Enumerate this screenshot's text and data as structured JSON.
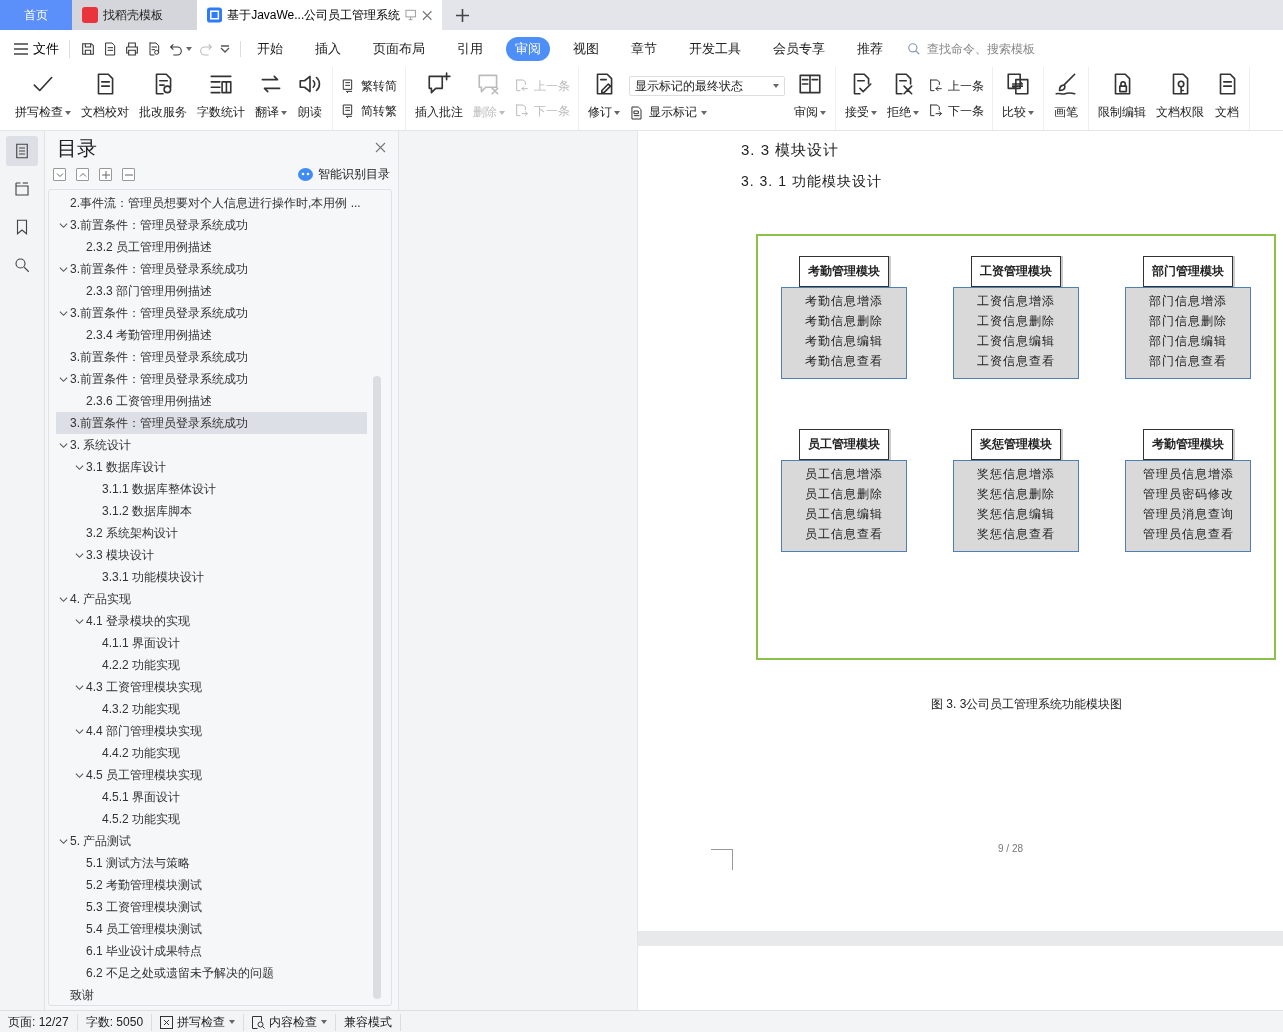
{
  "app_tabs": [
    {
      "kind": "home",
      "label": "首页",
      "selected": false
    },
    {
      "kind": "template",
      "label": "找稻壳模板",
      "selected": false
    },
    {
      "kind": "doc",
      "label": "基于JavaWe...公司员工管理系统",
      "selected": true
    }
  ],
  "menu": {
    "file": "文件",
    "tabs": [
      {
        "label": "开始",
        "selected": false
      },
      {
        "label": "插入",
        "selected": false
      },
      {
        "label": "页面布局",
        "selected": false
      },
      {
        "label": "引用",
        "selected": false
      },
      {
        "label": "审阅",
        "selected": true
      },
      {
        "label": "视图",
        "selected": false
      },
      {
        "label": "章节",
        "selected": false
      },
      {
        "label": "开发工具",
        "selected": false
      },
      {
        "label": "会员专享",
        "selected": false
      },
      {
        "label": "推荐",
        "selected": false
      }
    ],
    "search": {
      "placeholder": "查找命令、搜索模板"
    }
  },
  "ribbon": [
    {
      "items": [
        {
          "kind": "large",
          "label": "拼写检查",
          "caret": true,
          "disabled": false
        },
        {
          "kind": "large",
          "label": "文档校对",
          "caret": false,
          "disabled": false
        },
        {
          "kind": "large",
          "label": "批改服务",
          "caret": false,
          "disabled": false
        },
        {
          "kind": "large",
          "label": "字数统计",
          "caret": false,
          "disabled": false
        },
        {
          "kind": "large",
          "label": "翻译",
          "caret": true,
          "disabled": false
        },
        {
          "kind": "large",
          "label": "朗读",
          "caret": false,
          "disabled": false
        }
      ]
    },
    {
      "items": [
        {
          "kind": "stack",
          "items": [
            {
              "label": "繁转简",
              "caret": false,
              "disabled": false
            },
            {
              "label": "简转繁",
              "caret": false,
              "disabled": false
            }
          ]
        }
      ]
    },
    {
      "items": [
        {
          "kind": "large",
          "label": "插入批注",
          "caret": false,
          "disabled": false
        },
        {
          "kind": "large",
          "label": "删除",
          "caret": true,
          "disabled": true
        },
        {
          "kind": "stack",
          "items": [
            {
              "label": "上一条",
              "caret": false,
              "disabled": true
            },
            {
              "label": "下一条",
              "caret": false,
              "disabled": true
            }
          ]
        }
      ]
    },
    {
      "items": [
        {
          "kind": "large",
          "label": "修订",
          "caret": true,
          "disabled": false
        },
        {
          "kind": "stack",
          "items": [
            {
              "kind": "select",
              "label": "显示标记的最终状态",
              "caret": true
            },
            {
              "label": "显示标记",
              "caret": true,
              "disabled": false
            }
          ]
        },
        {
          "kind": "large",
          "label": "审阅",
          "caret": true,
          "disabled": false
        }
      ]
    },
    {
      "items": [
        {
          "kind": "large",
          "label": "接受",
          "caret": true,
          "disabled": false
        },
        {
          "kind": "large",
          "label": "拒绝",
          "caret": true,
          "disabled": false
        },
        {
          "kind": "stack",
          "items": [
            {
              "label": "上一条",
              "caret": false,
              "disabled": false
            },
            {
              "label": "下一条",
              "caret": false,
              "disabled": false
            }
          ]
        }
      ]
    },
    {
      "items": [
        {
          "kind": "large",
          "label": "比较",
          "caret": true,
          "disabled": false
        }
      ]
    },
    {
      "items": [
        {
          "kind": "large",
          "label": "画笔",
          "caret": false,
          "disabled": false
        }
      ]
    },
    {
      "items": [
        {
          "kind": "large",
          "label": "限制编辑",
          "caret": false,
          "disabled": false
        },
        {
          "kind": "large",
          "label": "文档权限",
          "caret": false,
          "disabled": false
        },
        {
          "kind": "large",
          "label": "文档",
          "caret": false,
          "disabled": false
        }
      ]
    }
  ],
  "rail": [
    {
      "selected": true
    },
    {
      "selected": false
    },
    {
      "selected": false
    },
    {
      "selected": false
    }
  ],
  "outline_panel": {
    "title": "目录",
    "smart_button": "智能识别目录",
    "items": [
      {
        "label": "2.事件流：管理员想要对个人信息进行操作时,本用例 ...",
        "selected": false
      },
      {
        "label": "3.前置条件：管理员登录系统成功",
        "selected": false,
        "expanded": true,
        "children": [
          {
            "label": "2.3.2 员工管理用例描述",
            "selected": false
          }
        ]
      },
      {
        "label": "3.前置条件：管理员登录系统成功",
        "selected": false,
        "expanded": true,
        "children": [
          {
            "label": "2.3.3 部门管理用例描述",
            "selected": false
          }
        ]
      },
      {
        "label": "3.前置条件：管理员登录系统成功",
        "selected": false,
        "expanded": true,
        "children": [
          {
            "label": "2.3.4 考勤管理用例描述",
            "selected": false
          }
        ]
      },
      {
        "label": "3.前置条件：管理员登录系统成功",
        "selected": false
      },
      {
        "label": "3.前置条件：管理员登录系统成功",
        "selected": false,
        "expanded": true,
        "children": [
          {
            "label": "2.3.6 工资管理用例描述",
            "selected": false
          }
        ]
      },
      {
        "label": "3.前置条件：管理员登录系统成功",
        "selected": true
      },
      {
        "label": "3. 系统设计",
        "selected": false,
        "expanded": true,
        "children": [
          {
            "label": "3.1 数据库设计",
            "selected": false,
            "expanded": true,
            "children": [
              {
                "label": "3.1.1 数据库整体设计",
                "selected": false
              },
              {
                "label": "3.1.2 数据库脚本",
                "selected": false
              }
            ]
          },
          {
            "label": "3.2 系统架构设计",
            "selected": false
          },
          {
            "label": "3.3 模块设计",
            "selected": false,
            "expanded": true,
            "children": [
              {
                "label": "3.3.1 功能模块设计",
                "selected": false
              }
            ]
          }
        ]
      },
      {
        "label": "4. 产品实现",
        "selected": false,
        "expanded": true,
        "children": [
          {
            "label": "4.1 登录模块的实现",
            "selected": false,
            "expanded": true,
            "children": [
              {
                "label": "4.1.1 界面设计",
                "selected": false
              },
              {
                "label": "4.2.2 功能实现",
                "selected": false
              }
            ]
          },
          {
            "label": "4.3 工资管理模块实现",
            "selected": false,
            "expanded": true,
            "children": [
              {
                "label": "4.3.2 功能实现",
                "selected": false
              }
            ]
          },
          {
            "label": "4.4 部门管理模块实现",
            "selected": false,
            "expanded": true,
            "children": [
              {
                "label": "4.4.2 功能实现",
                "selected": false
              }
            ]
          },
          {
            "label": "4.5 员工管理模块实现",
            "selected": false,
            "expanded": true,
            "children": [
              {
                "label": "4.5.1 界面设计",
                "selected": false
              },
              {
                "label": "4.5.2 功能实现",
                "selected": false
              }
            ]
          }
        ]
      },
      {
        "label": "5. 产品测试",
        "selected": false,
        "expanded": true,
        "children": [
          {
            "label": "5.1 测试方法与策略",
            "selected": false
          },
          {
            "label": "5.2 考勤管理模块测试",
            "selected": false
          },
          {
            "label": "5.3 工资管理模块测试",
            "selected": false
          },
          {
            "label": "5.4 员工管理模块测试",
            "selected": false
          },
          {
            "label": "6.1 毕业设计成果特点",
            "selected": false
          },
          {
            "label": "6.2 不足之处或遗留未予解决的问题",
            "selected": false
          }
        ]
      },
      {
        "label": "致谢",
        "selected": false
      }
    ]
  },
  "document": {
    "heading": "3. 3 模块设计",
    "subheading": "3. 3. 1 功能模块设计",
    "modules": [
      {
        "title": "考勤管理模块",
        "items": [
          "考勤信息增添",
          "考勤信息删除",
          "考勤信息编辑",
          "考勤信息查看"
        ]
      },
      {
        "title": "工资管理模块",
        "items": [
          "工资信息增添",
          "工资信息删除",
          "工资信息编辑",
          "工资信息查看"
        ]
      },
      {
        "title": "部门管理模块",
        "items": [
          "部门信息增添",
          "部门信息删除",
          "部门信息编辑",
          "部门信息查看"
        ]
      },
      {
        "title": "员工管理模块",
        "items": [
          "员工信息增添",
          "员工信息删除",
          "员工信息编辑",
          "员工信息查看"
        ]
      },
      {
        "title": "奖惩管理模块",
        "items": [
          "奖惩信息增添",
          "奖惩信息删除",
          "奖惩信息编辑",
          "奖惩信息查看"
        ]
      },
      {
        "title": "考勤管理模块",
        "items": [
          "管理员信息增添",
          "管理员密码修改",
          "管理员消息查询",
          "管理员信息查看"
        ]
      }
    ],
    "caption": "图 3. 3公司员工管理系统功能模块图",
    "page_number": "9 / 28"
  },
  "status_bar": {
    "page": "页面: 12/27",
    "words": "字数: 5050",
    "spell": "拼写检查",
    "content": "内容检查",
    "mode": "兼容模式"
  }
}
